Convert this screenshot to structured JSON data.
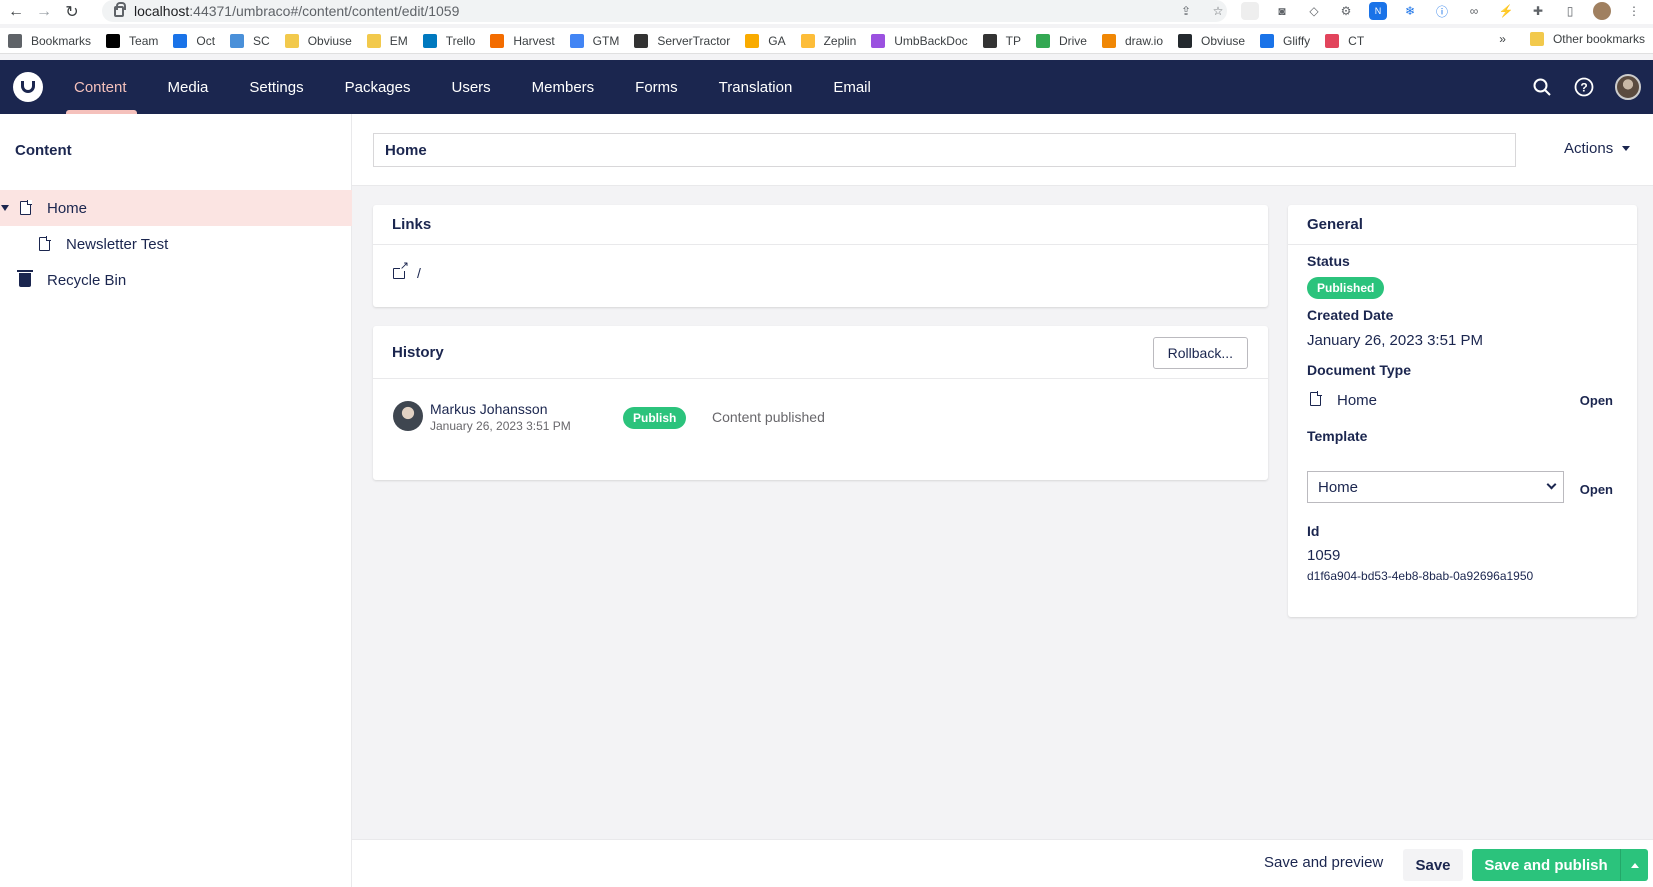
{
  "browser": {
    "url_host": "localhost",
    "url_path": ":44371/umbraco#/content/content/edit/1059",
    "bookmarks": [
      {
        "label": "Bookmarks",
        "color": "#5f6368"
      },
      {
        "label": "Team",
        "color": "#000000"
      },
      {
        "label": "Oct",
        "color": "#1a73e8"
      },
      {
        "label": "SC",
        "color": "#4a90d9"
      },
      {
        "label": "Obviuse",
        "color": "#f2c94c"
      },
      {
        "label": "EM",
        "color": "#f2c94c"
      },
      {
        "label": "Trello",
        "color": "#0079bf"
      },
      {
        "label": "Harvest",
        "color": "#f36c00"
      },
      {
        "label": "GTM",
        "color": "#4285f4"
      },
      {
        "label": "ServerTractor",
        "color": "#333333"
      },
      {
        "label": "GA",
        "color": "#f9ab00"
      },
      {
        "label": "Zeplin",
        "color": "#fdbd39"
      },
      {
        "label": "UmbBackDoc",
        "color": "#9b51e0"
      },
      {
        "label": "TP",
        "color": "#333333"
      },
      {
        "label": "Drive",
        "color": "#34a853"
      },
      {
        "label": "draw.io",
        "color": "#f08705"
      },
      {
        "label": "Obviuse",
        "color": "#24292e"
      },
      {
        "label": "Gliffy",
        "color": "#1a73e8"
      },
      {
        "label": "CT",
        "color": "#e2445c"
      }
    ],
    "more": "»",
    "other_bookmarks": "Other bookmarks"
  },
  "header": {
    "sections": [
      "Content",
      "Media",
      "Settings",
      "Packages",
      "Users",
      "Members",
      "Forms",
      "Translation",
      "Email"
    ],
    "active_section": "Content"
  },
  "tree": {
    "title": "Content",
    "items": [
      {
        "label": "Home",
        "icon": "document-icon"
      },
      {
        "label": "Newsletter Test",
        "icon": "document-icon"
      },
      {
        "label": "Recycle Bin",
        "icon": "trash-icon"
      }
    ]
  },
  "editor": {
    "name": "Home",
    "actions_label": "Actions"
  },
  "links": {
    "title": "Links",
    "url": "/"
  },
  "history": {
    "title": "History",
    "rollback_label": "Rollback...",
    "entries": [
      {
        "user": "Markus Johansson",
        "date": "January 26, 2023 3:51 PM",
        "badge": "Publish",
        "text": "Content published"
      }
    ]
  },
  "general": {
    "title": "General",
    "status_label": "Status",
    "status_value": "Published",
    "created_label": "Created Date",
    "created_value": "January 26, 2023 3:51 PM",
    "doctype_label": "Document Type",
    "doctype_value": "Home",
    "open_label": "Open",
    "template_label": "Template",
    "template_value": "Home",
    "id_label": "Id",
    "id_value": "1059",
    "guid": "d1f6a904-bd53-4eb8-8bab-0a92696a1950"
  },
  "footer": {
    "save_preview": "Save and preview",
    "save": "Save",
    "save_publish": "Save and publish"
  },
  "colors": {
    "header_bg": "#1b264f",
    "accent": "#f5c1bc",
    "success": "#2bc37c"
  }
}
